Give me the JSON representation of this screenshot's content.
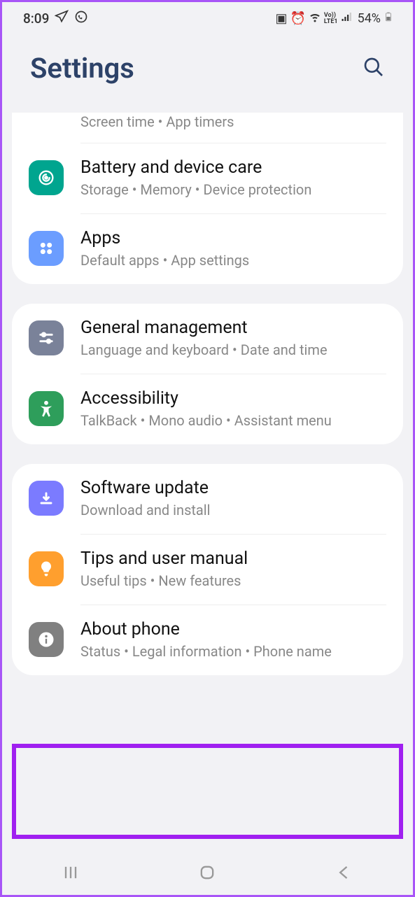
{
  "status": {
    "time": "8:09",
    "battery": "54%"
  },
  "header": {
    "title": "Settings"
  },
  "groups": [
    {
      "items": [
        {
          "id": "screen-time",
          "partial": true,
          "title": "",
          "sub": "Screen time  •  App timers"
        },
        {
          "id": "battery",
          "iconColor": "#00a58f",
          "title": "Battery and device care",
          "sub": "Storage  •  Memory  •  Device protection"
        },
        {
          "id": "apps",
          "iconColor": "#6b9dff",
          "title": "Apps",
          "sub": "Default apps  •  App settings"
        }
      ]
    },
    {
      "items": [
        {
          "id": "general",
          "iconColor": "#7a8299",
          "title": "General management",
          "sub": "Language and keyboard  •  Date and time"
        },
        {
          "id": "accessibility",
          "iconColor": "#2e9e5b",
          "title": "Accessibility",
          "sub": "TalkBack  •  Mono audio  •  Assistant menu"
        }
      ]
    },
    {
      "items": [
        {
          "id": "software",
          "iconColor": "#7b7bff",
          "title": "Software update",
          "sub": "Download and install"
        },
        {
          "id": "tips",
          "iconColor": "#ff9f2e",
          "title": "Tips and user manual",
          "sub": "Useful tips  •  New features"
        },
        {
          "id": "about",
          "iconColor": "#808080",
          "title": "About phone",
          "sub": "Status  •  Legal information  •  Phone name"
        }
      ]
    }
  ]
}
